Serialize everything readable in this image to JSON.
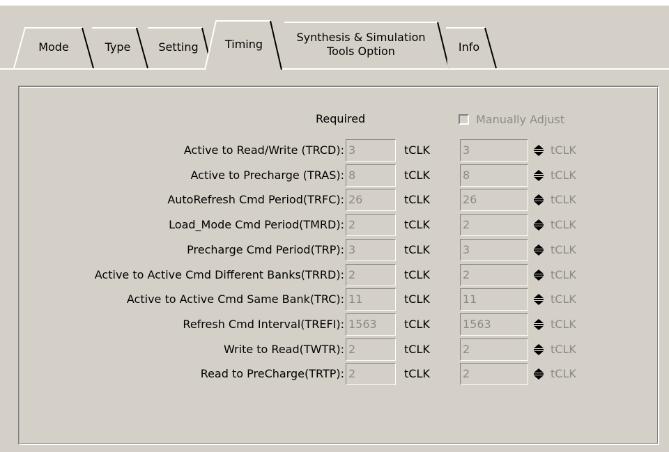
{
  "tabs": [
    {
      "label": "Mode"
    },
    {
      "label": "Type"
    },
    {
      "label": "Setting"
    },
    {
      "label": "Timing",
      "active": true
    },
    {
      "label_line1": "Synthesis & Simulation",
      "label_line2": "Tools Option"
    },
    {
      "label": "Info"
    }
  ],
  "header": {
    "required": "Required",
    "manual_adjust": "Manually Adjust",
    "manual_adjust_checked": false
  },
  "unit": "tCLK",
  "rows": [
    {
      "label": "Active to Read/Write (TRCD):",
      "required": "3",
      "adjust": "3"
    },
    {
      "label": "Active to Precharge (TRAS):",
      "required": "8",
      "adjust": "8"
    },
    {
      "label": "AutoRefresh Cmd Period(TRFC):",
      "required": "26",
      "adjust": "26"
    },
    {
      "label": "Load_Mode Cmd Period(TMRD):",
      "required": "2",
      "adjust": "2"
    },
    {
      "label": "Precharge Cmd Period(TRP):",
      "required": "3",
      "adjust": "3"
    },
    {
      "label": "Active to Active Cmd Different Banks(TRRD):",
      "required": "2",
      "adjust": "2"
    },
    {
      "label": "Active to Active Cmd Same Bank(TRC):",
      "required": "11",
      "adjust": "11"
    },
    {
      "label": "Refresh Cmd Interval(TREFI):",
      "required": "1563",
      "adjust": "1563"
    },
    {
      "label": "Write to Read(TWTR):",
      "required": "2",
      "adjust": "2"
    },
    {
      "label": "Read to PreCharge(TRTP):",
      "required": "2",
      "adjust": "2"
    }
  ],
  "colors": {
    "face": "#d4d0c8",
    "shadow": "#808080",
    "highlight": "#ffffff",
    "disabled_text": "#8c8a85"
  }
}
